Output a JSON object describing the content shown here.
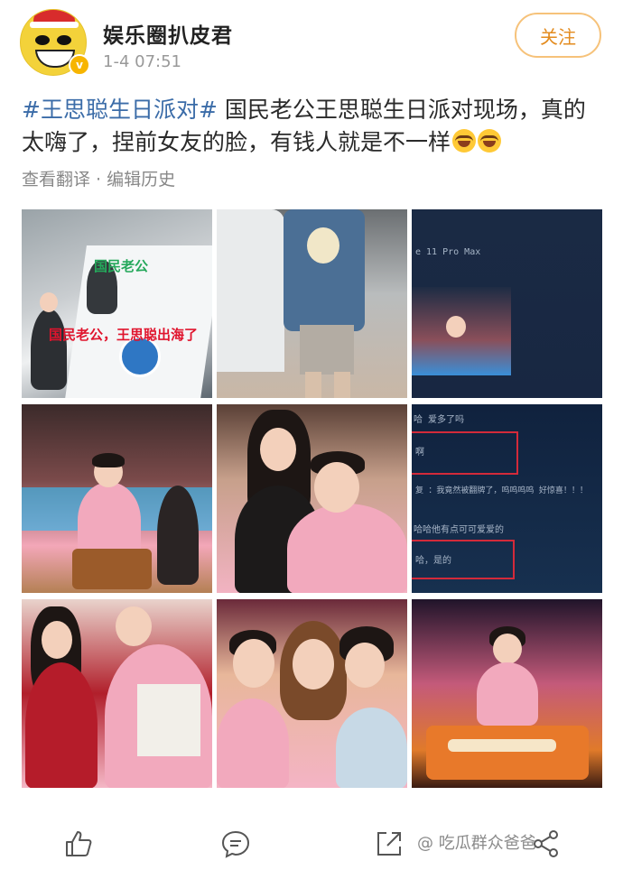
{
  "header": {
    "username": "娱乐圈扒皮君",
    "timestamp": "1-4 07:51",
    "follow_label": "关注",
    "verified_badge": "v"
  },
  "post": {
    "hashtag": "#王思聪生日派对#",
    "text": " 国民老公王思聪生日派对现场，真的太嗨了，捏前女友的脸，有钱人就是不一样",
    "emoji": "laugh-cry-icon"
  },
  "meta": {
    "translate": "查看翻译",
    "separator": "·",
    "edit_history": "编辑历史"
  },
  "photos": {
    "p1_caption_green": "国民老公",
    "p1_caption_red": "国民老公，王思聪出海了",
    "p3_screen_text": "e 11 Pro Max",
    "p6_lines": [
      "哈 爱多了吗",
      "啊",
      "复      ：我竟然被翻牌了，呜呜呜呜 好惊喜！！！",
      "哈哈他有点可可爱爱的",
      "哈，是的"
    ]
  },
  "actions": {
    "like": "like-icon",
    "comment": "comment-icon",
    "share": "share-icon",
    "forward": "forward-icon"
  },
  "watermark": "@ 吃瓜群众爸爸",
  "colors": {
    "hashtag": "#3b6ca8",
    "follow": "#e38b1e",
    "follow_border": "#f6c27a"
  }
}
